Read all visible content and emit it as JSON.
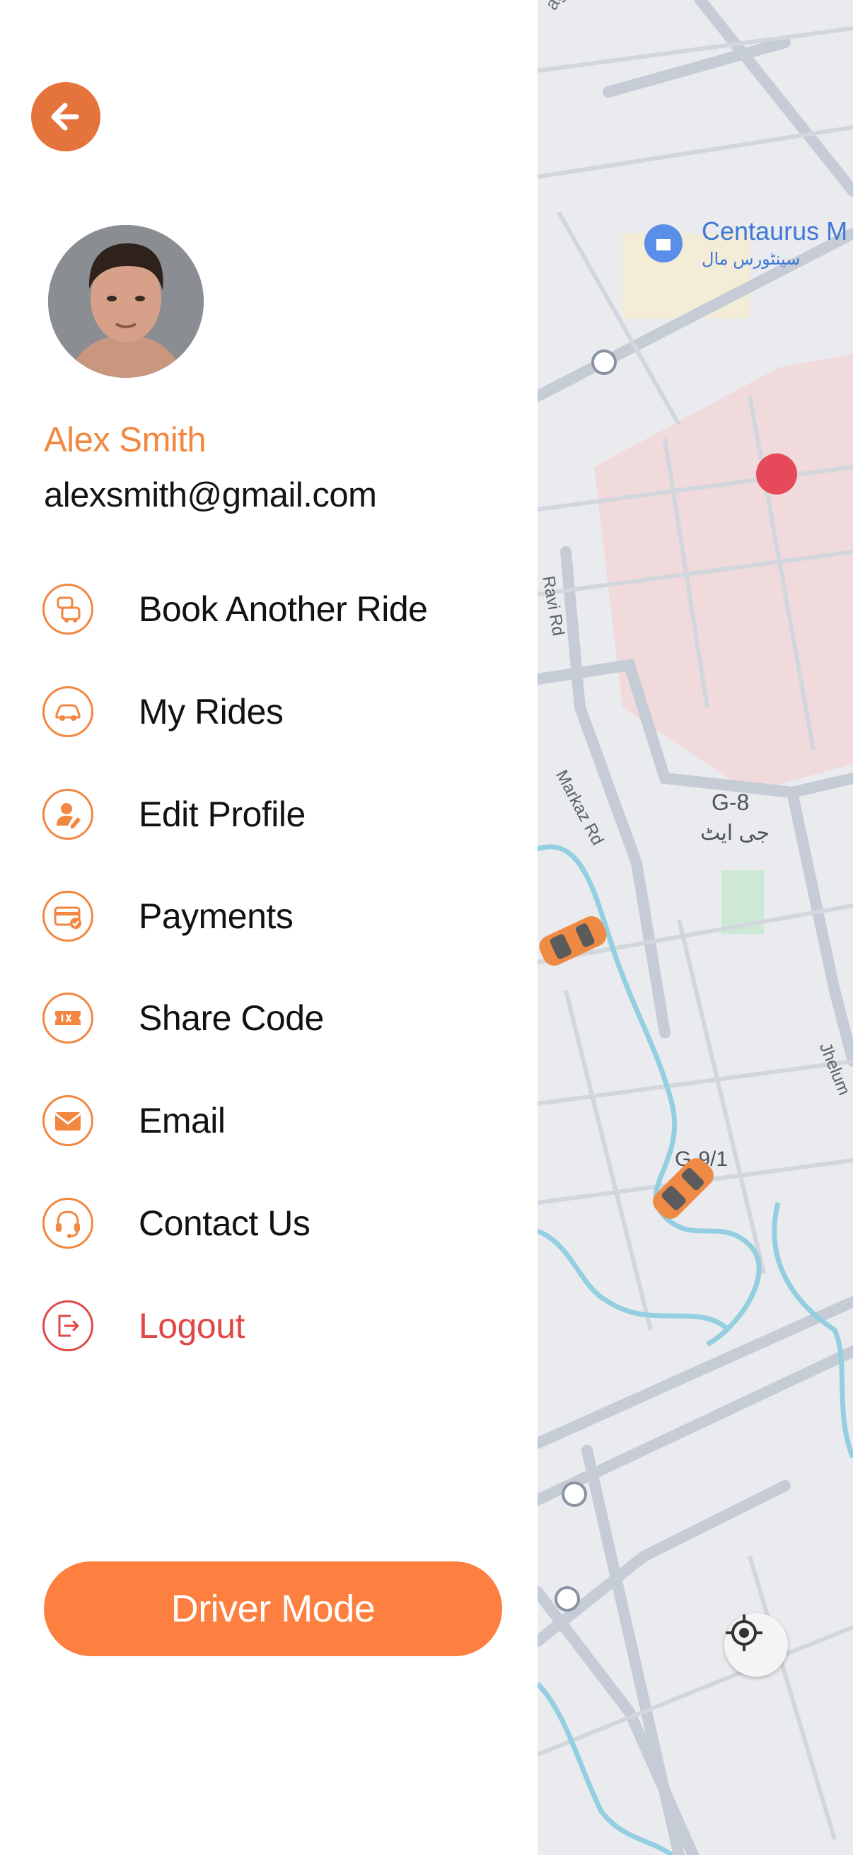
{
  "profile": {
    "name": "Alex Smith",
    "email": "alexsmith@gmail.com"
  },
  "menu": [
    {
      "label": "Book Another Ride",
      "icon": "car-pair-icon"
    },
    {
      "label": "My Rides",
      "icon": "car-icon"
    },
    {
      "label": "Edit Profile",
      "icon": "user-edit-icon"
    },
    {
      "label": "Payments",
      "icon": "card-check-icon"
    },
    {
      "label": "Share Code",
      "icon": "ticket-icon"
    },
    {
      "label": "Email",
      "icon": "envelope-icon"
    },
    {
      "label": "Contact Us",
      "icon": "headset-icon"
    },
    {
      "label": "Logout",
      "icon": "logout-icon"
    }
  ],
  "driver_mode_label": "Driver Mode",
  "map": {
    "place_centaurus_en": "Centaurus M",
    "place_centaurus_ur": "سینٹورس مال",
    "road_ravi": "Ravi Rd",
    "road_markaz": "Markaz Rd",
    "sector_g8": "G-8",
    "sector_g8_ur": "جی ایٹ",
    "sector_g9": "G-9/1",
    "road_jhelum": "Jhelum",
    "road_top": "aghan"
  },
  "colors": {
    "accent": "#fe8040",
    "back_button": "#e5743c",
    "name": "#f28741",
    "logout": "#e04848"
  }
}
